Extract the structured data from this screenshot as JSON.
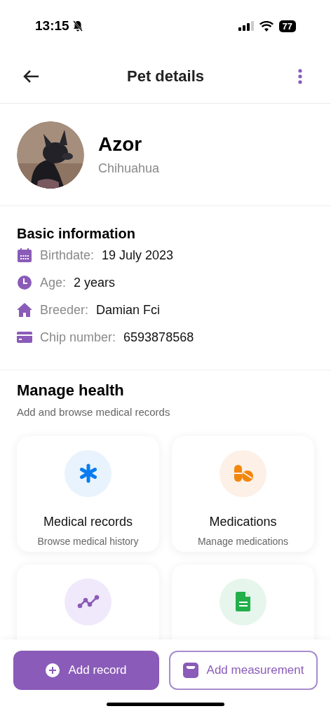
{
  "status_bar": {
    "time": "13:15",
    "battery": "77"
  },
  "header": {
    "title": "Pet details"
  },
  "pet": {
    "name": "Azor",
    "breed": "Chihuahua"
  },
  "basic_info": {
    "title": "Basic information",
    "rows": [
      {
        "kind": "birthdate",
        "label": "Birthdate:",
        "value": "19 July 2023"
      },
      {
        "kind": "age",
        "label": "Age:",
        "value": "2 years"
      },
      {
        "kind": "breeder",
        "label": "Breeder:",
        "value": "Damian Fci"
      },
      {
        "kind": "chip",
        "label": "Chip number:",
        "value": "6593878568"
      }
    ]
  },
  "manage_health": {
    "title": "Manage health",
    "subtitle": "Add and browse medical records",
    "cards": [
      {
        "kind": "records",
        "title": "Medical records",
        "subtitle": "Browse medical history"
      },
      {
        "kind": "medications",
        "title": "Medications",
        "subtitle": "Manage medications"
      },
      {
        "kind": "measurements"
      },
      {
        "kind": "notes"
      }
    ]
  },
  "actions": [
    {
      "kind": "primary",
      "label": "Add record"
    },
    {
      "kind": "secondary",
      "label": "Add measurement"
    }
  ]
}
